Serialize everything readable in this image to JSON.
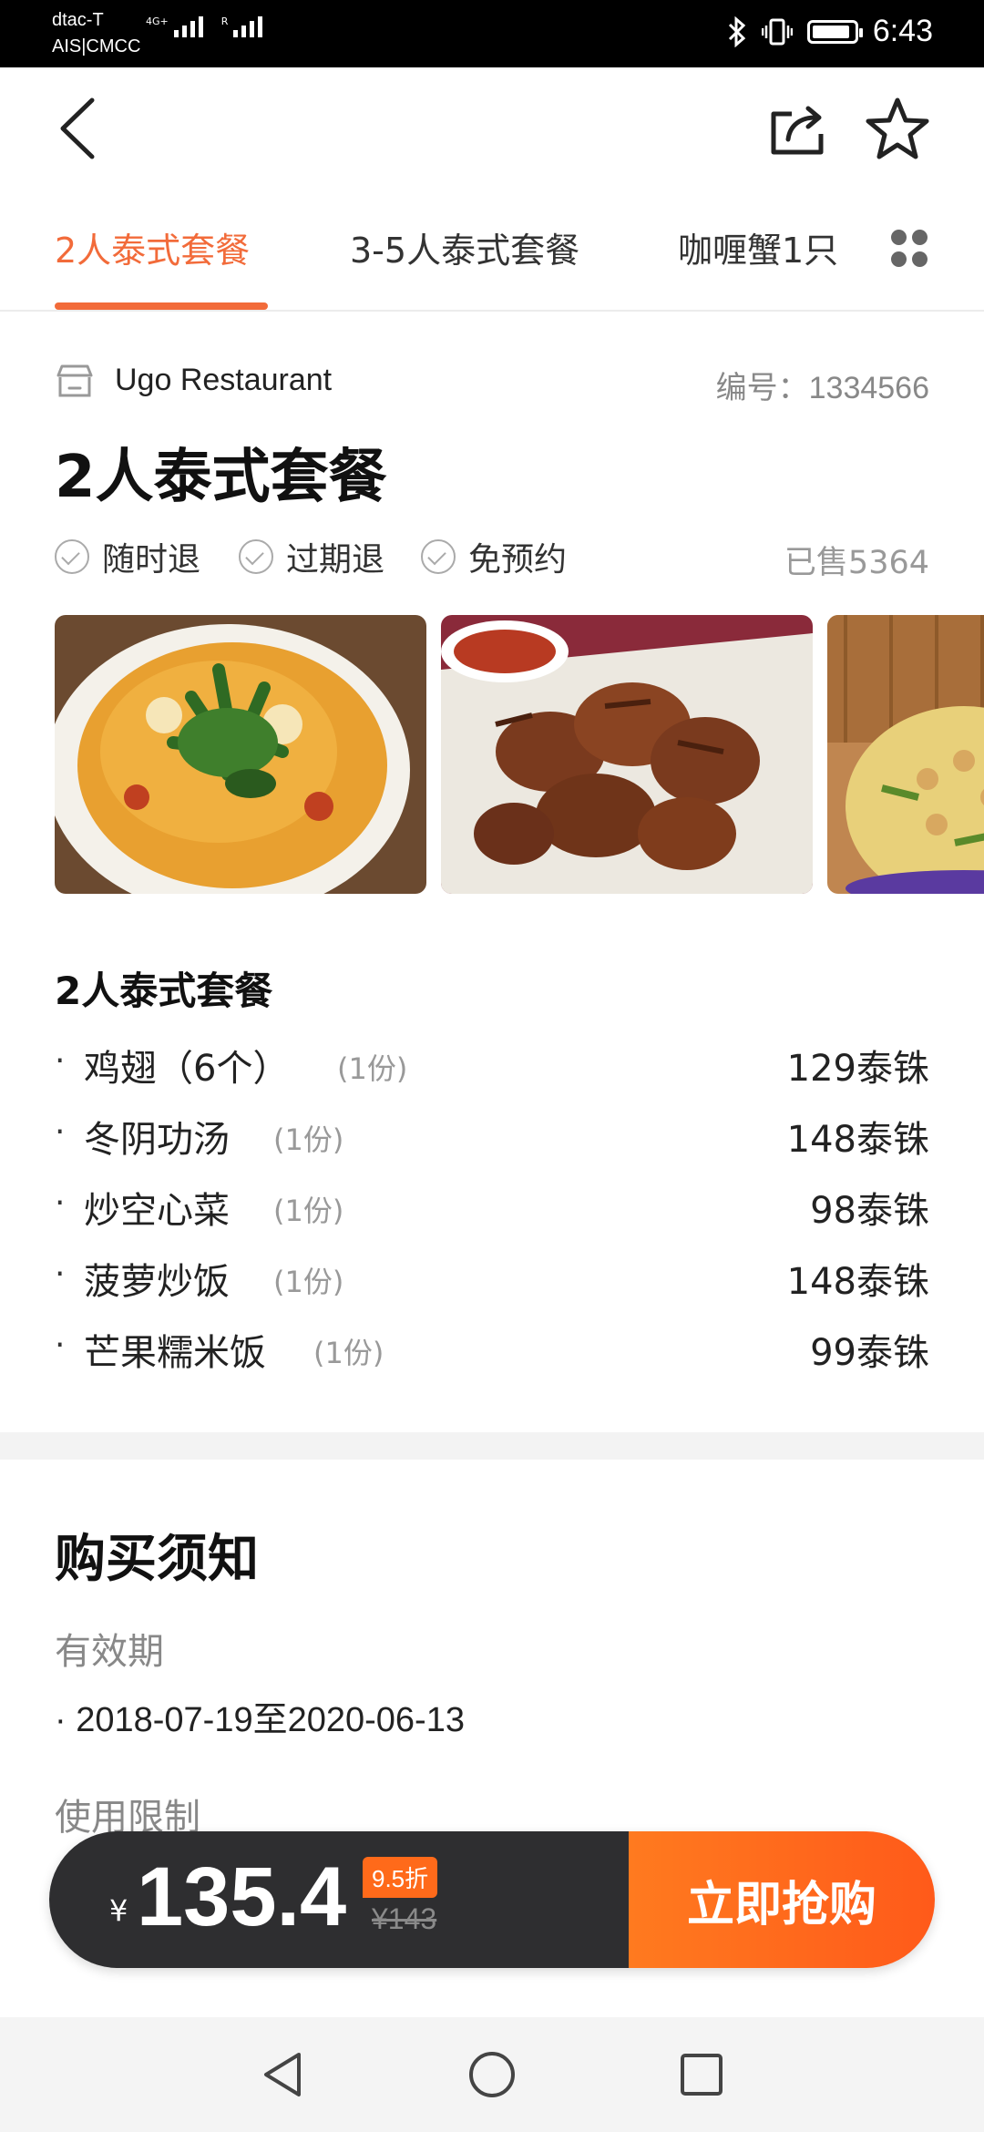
{
  "status_bar": {
    "carrier_line1": "dtac-T",
    "carrier_line2": "AIS|CMCC",
    "signal1_tag": "4G+",
    "signal2_tag": "R",
    "time": "6:43"
  },
  "nav": {
    "back_icon": "back-arrow",
    "share_icon": "share",
    "favorite_icon": "star-outline"
  },
  "tabs": [
    {
      "label": "2人泰式套餐",
      "active": true
    },
    {
      "label": "3-5人泰式套餐",
      "active": false
    },
    {
      "label": "咖喱蟹1只",
      "active": false
    }
  ],
  "restaurant": {
    "name": "Ugo Restaurant",
    "code": "编号：1334566"
  },
  "deal": {
    "title": "2人泰式套餐",
    "features": [
      "随时退",
      "过期退",
      "免预约"
    ],
    "sold": "已售5364"
  },
  "photos": [
    "tom-yum-soup",
    "fried-chicken-drumsticks",
    "pineapple-fried-rice"
  ],
  "package": {
    "title": "2人泰式套餐",
    "items": [
      {
        "bullet": "·",
        "name": "鸡翅（6个）",
        "qty": "(1份)",
        "price": "129泰铢"
      },
      {
        "bullet": "·",
        "name": "冬阴功汤",
        "qty": "(1份)",
        "price": "148泰铢"
      },
      {
        "bullet": "·",
        "name": "炒空心菜",
        "qty": "(1份)",
        "price": "98泰铢"
      },
      {
        "bullet": "·",
        "name": "菠萝炒饭",
        "qty": "(1份)",
        "price": "148泰铢"
      },
      {
        "bullet": "·",
        "name": "芒果糯米饭",
        "qty": "(1份)",
        "price": "99泰铢"
      }
    ]
  },
  "notice": {
    "title": "购买须知",
    "validity_label": "有效期",
    "validity_value": "· 2018-07-19至2020-06-13",
    "usage_label": "使用限制"
  },
  "buy_bar": {
    "currency": "¥",
    "price": "135.4",
    "discount": "9.5折",
    "original_price": "¥143",
    "button_label": "立即抢购"
  },
  "colors": {
    "accent": "#f26b3a",
    "buy_button": "#ff6a1a",
    "price_bar_bg": "#2e2e30"
  }
}
